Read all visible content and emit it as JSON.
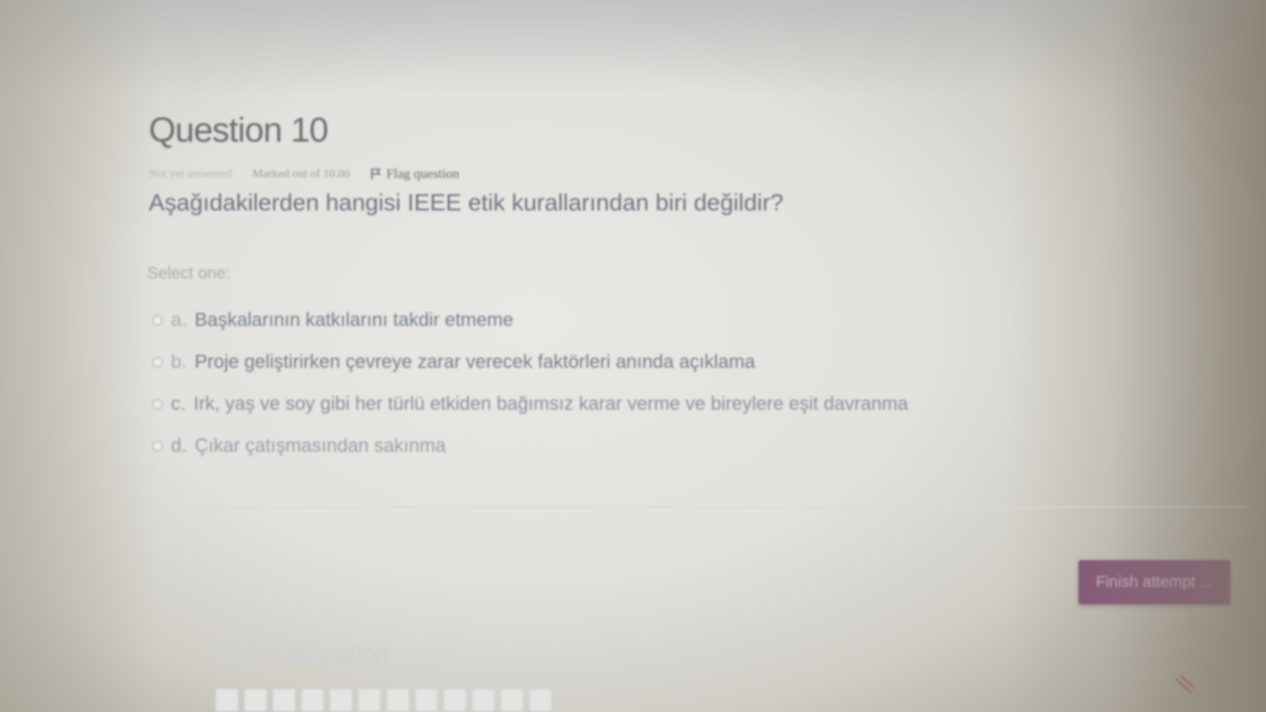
{
  "question": {
    "title": "Question 10",
    "status": "Not yet answered",
    "marks": "Marked out of 10.00",
    "flag_label": "Flag question",
    "text": "Aşağıdakilerden hangisi IEEE etik kurallarından biri değildir?",
    "select_prompt": "Select one:",
    "options": [
      {
        "letter": "a.",
        "text": "Başkalarının katkılarını takdir etmeme"
      },
      {
        "letter": "b.",
        "text": "Proje geliştirirken çevreye zarar verecek faktörleri anında açıklama"
      },
      {
        "letter": "c.",
        "text": "Irk, yaş ve soy gibi her türlü etkiden bağımsız karar verme ve bireylere eşit davranma"
      },
      {
        "letter": "d.",
        "text": "Çıkar çatışmasından sakınma"
      }
    ]
  },
  "actions": {
    "finish_label": "Finish attempt ..."
  },
  "quiz_navigation": {
    "title": "Quiz navigation"
  },
  "icons": {
    "flag": "flag-icon",
    "corner": "block-toggle-icon"
  },
  "colors": {
    "accent": "#7f4c74"
  }
}
